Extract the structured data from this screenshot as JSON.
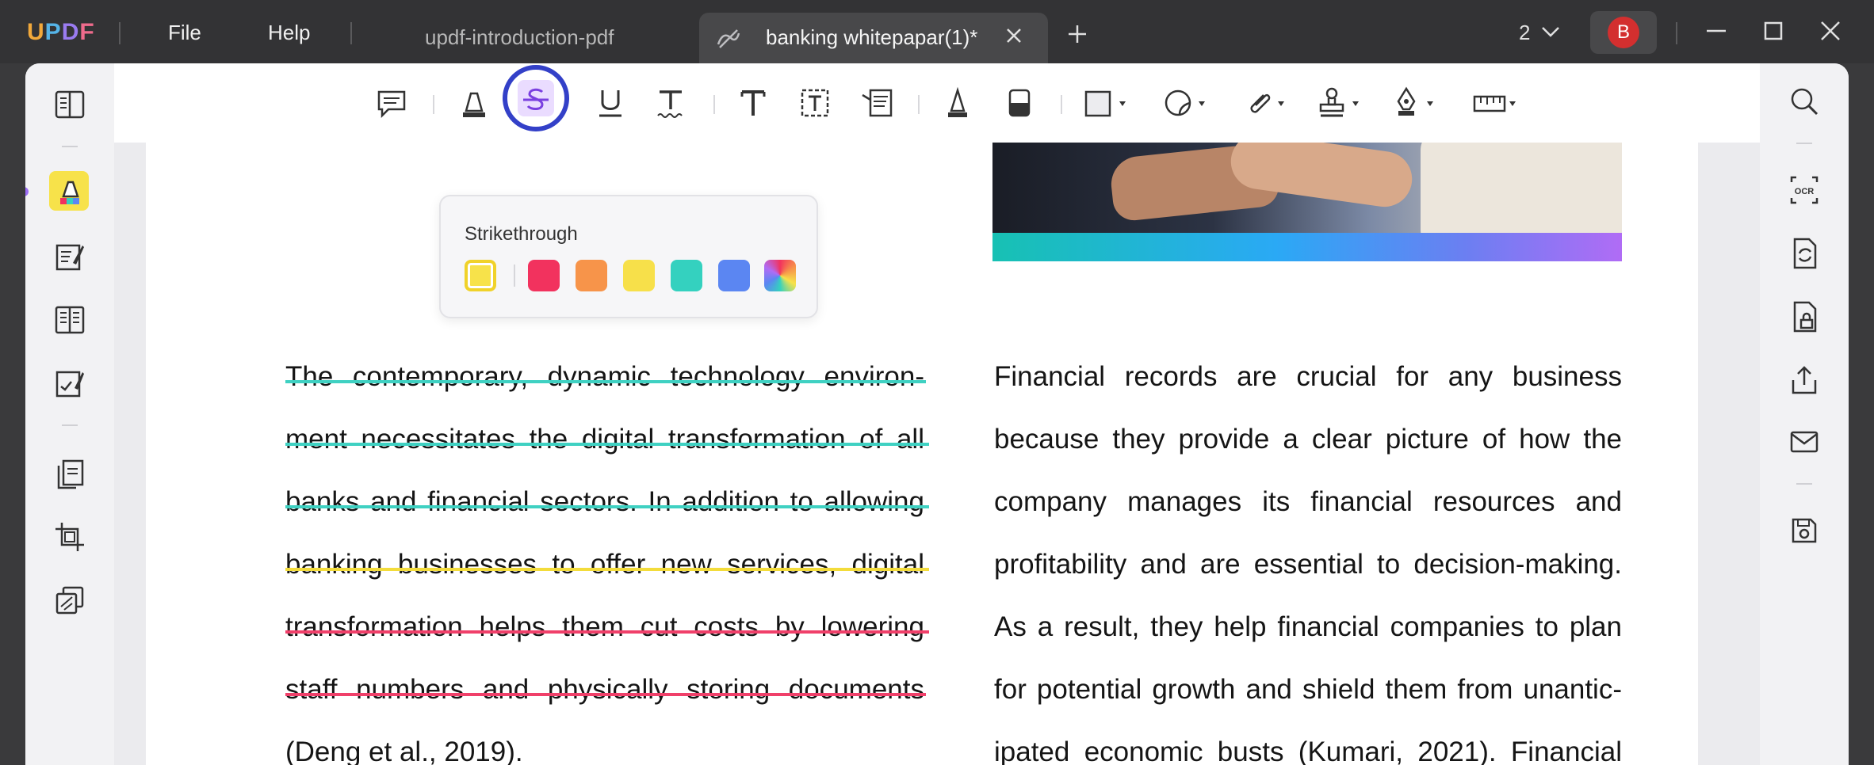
{
  "app": {
    "logo": [
      "U",
      "P",
      "D",
      "F"
    ],
    "menu": {
      "file": "File",
      "help": "Help"
    },
    "tabs": [
      {
        "label": "updf-introduction-pdf",
        "active": false
      },
      {
        "label": "banking whitepapar(1)*",
        "active": true
      }
    ],
    "page_count": "2",
    "user_initial": "B"
  },
  "left_sidebar": {
    "items": [
      "reader-icon",
      "comment-highlighter-icon",
      "edit-pdf-icon",
      "page-layout-icon",
      "fill-sign-icon",
      "organize-pages-icon",
      "crop-icon",
      "batch-icon"
    ],
    "active": "comment-highlighter-icon"
  },
  "right_sidebar": {
    "items": [
      "search-icon",
      "ocr-icon",
      "convert-icon",
      "protect-icon",
      "share-icon",
      "email-icon",
      "save-icon"
    ],
    "ocr_label": "OCR"
  },
  "toolbar": {
    "tools": [
      "comment-icon",
      "highlight-icon",
      "strikethrough-icon",
      "underline-icon",
      "squiggly-icon",
      "text-icon",
      "text-box-icon",
      "text-callout-icon",
      "pencil-icon",
      "eraser-icon",
      "shape-icon",
      "sticker-icon",
      "attachment-icon",
      "stamp-icon",
      "signature-icon",
      "measure-icon"
    ],
    "active": "strikethrough-icon"
  },
  "popup": {
    "title": "Strikethrough",
    "colors": [
      "#f7e24a",
      "#f2325e",
      "#f7944a",
      "#f7e04a",
      "#34d1bf",
      "#5b86f2",
      "rainbow"
    ],
    "selected": 0
  },
  "document": {
    "left_column": [
      {
        "text": "The contemporary, dynamic technology environ-",
        "strike": "#3fd1c2"
      },
      {
        "text": "ment necessitates the digital transformation of all",
        "strike": "#3fd1c2"
      },
      {
        "text": "banks and financial sectors. In addition to allowing",
        "strike": "#3fd1c2"
      },
      {
        "text": "banking businesses to offer new services, digital",
        "strike": "#f3dc3b"
      },
      {
        "text": "transformation helps them cut costs by lowering",
        "strike": "#f0406a"
      },
      {
        "text": "staff numbers and physically storing documents",
        "strike": "#f0406a"
      },
      {
        "text": "(Deng et al., 2019).",
        "strike": ""
      }
    ],
    "right_column": [
      "Financial records are crucial for any business",
      "because they provide a clear picture of how the",
      "company manages its financial resources and",
      "profitability and are essential to decision-making.",
      "As a result, they help financial companies to plan",
      "for potential growth and shield them from unantic-",
      "ipated economic busts (Kumari, 2021). Financial"
    ]
  }
}
